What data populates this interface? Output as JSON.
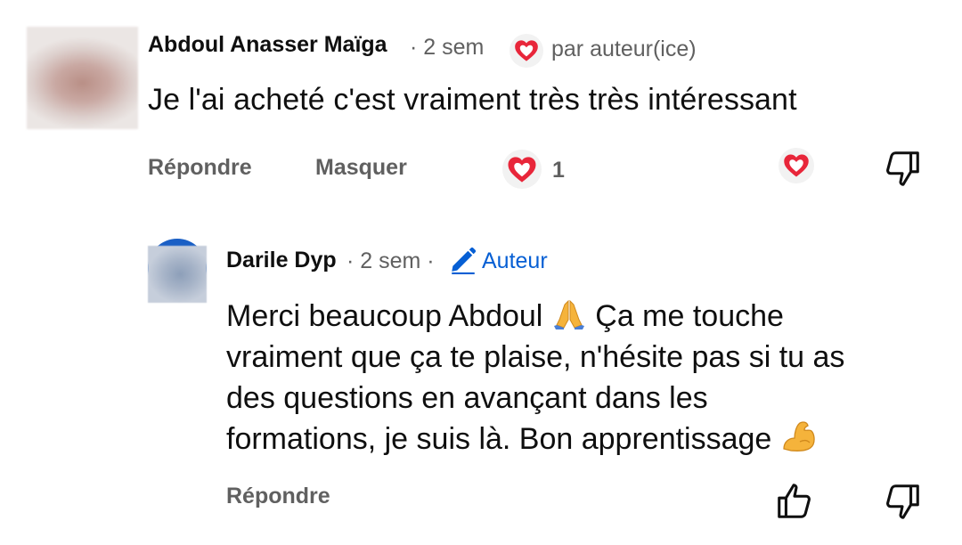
{
  "comment": {
    "author": "Abdoul Anasser Maïga",
    "time": "· 2 sem",
    "hearted_by_creator": "par auteur(ice)",
    "text": "Je l'ai acheté c'est vraiment très très intéressant",
    "actions": {
      "reply": "Répondre",
      "hide": "Masquer",
      "like_count": "1"
    },
    "icons": {
      "heart_badge": "heart-icon",
      "like": "heart-icon",
      "heart_button": "heart-icon",
      "dislike": "thumbs-down-icon"
    },
    "colors": {
      "heart_red": "#e8263a"
    }
  },
  "reply": {
    "author": "Darile Dyp",
    "time": "· 2 sem ·",
    "author_tag": "Auteur",
    "text_lines": [
      "Merci beaucoup Abdoul",
      "Ça me touche",
      "vraiment que ça te plaise, n'hésite pas si tu as",
      "des questions en avançant dans les",
      "formations, je suis là. Bon apprentissage"
    ],
    "emojis": [
      "folded-hands-emoji",
      "flexed-biceps-emoji"
    ],
    "actions": {
      "reply": "Répondre"
    },
    "icons": {
      "author_badge": "pencil-icon",
      "like": "thumbs-up-icon",
      "dislike": "thumbs-down-icon"
    },
    "colors": {
      "author_blue": "#065fd4"
    }
  }
}
